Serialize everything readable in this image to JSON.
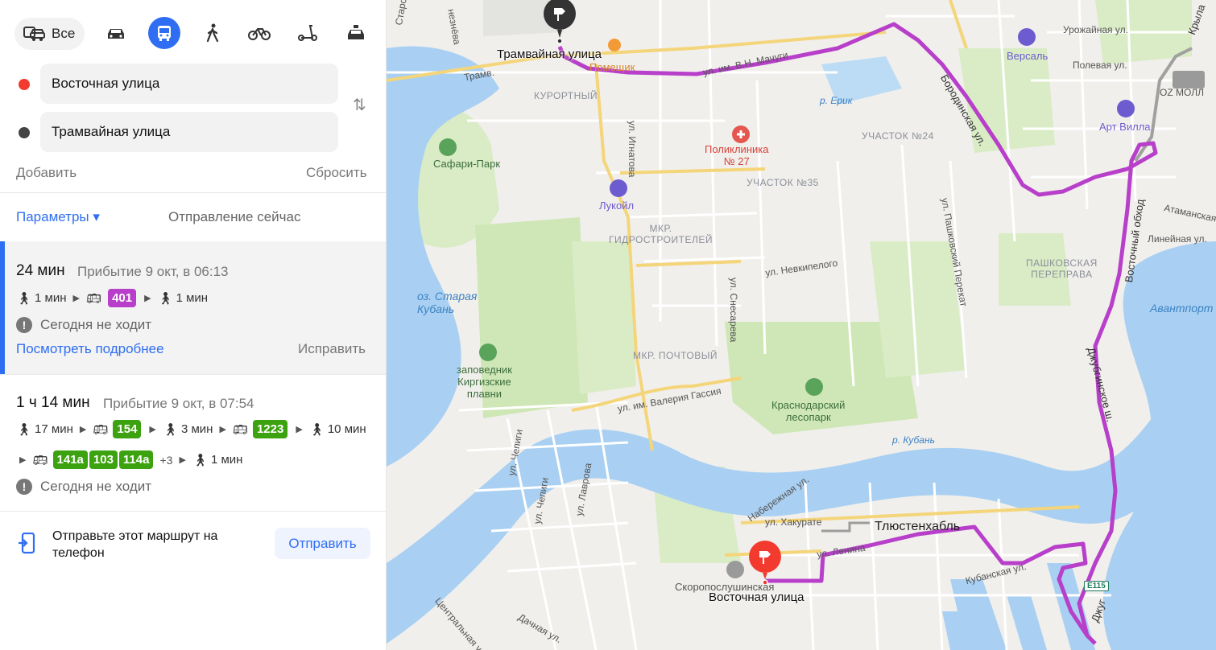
{
  "modes": {
    "all_label": "Все",
    "items": [
      {
        "name": "car-icon"
      },
      {
        "name": "bus-icon",
        "active": true
      },
      {
        "name": "walk-icon"
      },
      {
        "name": "bike-icon"
      },
      {
        "name": "scooter-icon"
      },
      {
        "name": "taxi-icon"
      }
    ]
  },
  "from": {
    "value": "Восточная улица",
    "color": "#f33a2f"
  },
  "to": {
    "value": "Трамвайная улица",
    "color": "#444444"
  },
  "actions": {
    "add": "Добавить",
    "reset": "Сбросить"
  },
  "params": {
    "label": "Параметры ▾",
    "departure": "Отправление сейчас"
  },
  "routes": [
    {
      "duration": "24 мин",
      "arrival": "Прибытие 9 окт, в 06:13",
      "walk1": "1 мин",
      "lines": [
        "401"
      ],
      "walk2": "1 мин",
      "status": "Сегодня не ходит",
      "details": "Посмотреть подробнее",
      "fix": "Исправить"
    },
    {
      "duration": "1 ч 14 мин",
      "arrival": "Прибытие 9 окт, в 07:54",
      "walk1": "17 мин",
      "line_a": "154",
      "walk2": "3 мин",
      "line_b": "1223",
      "walk3": "10 мин",
      "lines_c": [
        "141а",
        "103",
        "114а"
      ],
      "more": "+3",
      "walk4": "1 мин",
      "status": "Сегодня не ходит"
    }
  ],
  "send": {
    "text": "Отправьте этот маршрут на телефон",
    "button": "Отправить"
  },
  "colors": {
    "accent": "#2f6ef2",
    "route": "#b73fc9",
    "line_green": "#3ca20f"
  },
  "map": {
    "labels": {
      "tram_stop": "Трамвайная улица",
      "east_stop": "Восточная улица",
      "kurortny": "КУРОРТНЫЙ",
      "pomeshchik": "Помещик",
      "machuhi": "ул. им. В.Н. Мачуги",
      "versal": "Версаль",
      "oz_moll": "OZ МОЛЛ",
      "art_villa": "Арт Вилла",
      "urozhaynaya": "Урожайная ул.",
      "polevaya": "Полевая ул.",
      "erik": "р. Ерик",
      "uchastok24": "УЧАСТОК №24",
      "poliklinika": "Поликлиника\n№ 27",
      "ignatova": "ул. Игнатова",
      "safari": "Сафари-Парк",
      "uchastok35": "УЧАСТОК №35",
      "lukoil": "Лукойл",
      "gidro": "МКР.\nГИДРОСТРОИТЕЛЕЙ",
      "nevkipelogo": "ул. Невкипелого",
      "pashkovsky_per": "ул. Пашковский Перекат",
      "pashkovskaya": "ПАШКОВСКАЯ\nПЕРЕПРАВА",
      "atamanskaya": "Атаманская",
      "lineynaya": "Линейная ул.",
      "vostochny_obhod": "Восточный обход",
      "borodinskaya": "Бородинская ул.",
      "avanport": "Авантпорт",
      "staraya_kuban": "оз. Старая\nКубань",
      "snesareva": "ул. Снесарева",
      "pochtovy": "МКР. ПОЧТОВЫЙ",
      "zapovednik": "заповедник\nКиргизские\nплавни",
      "gassiya": "ул. им. Валерия Гассия",
      "lesopark": "Краснодарский\nлесопарк",
      "dzhubginskoe": "Джубгинское ш.",
      "kuban": "р. Кубань",
      "chepigi": "ул. Чепиги",
      "chepigi2": "ул. Чепиги",
      "lavrova": "ул. Лаврова",
      "naberezhnaya": "Набережная ул.",
      "hakurate": "ул. Хакурате",
      "tlyustenhabl": "Тлюстенхабль",
      "lenina": "ул. Ленина",
      "kubanskaya": "Кубанская ул.",
      "skorbyashchaya": "Скоропослушинская",
      "dachnaya": "Дачная ул.",
      "centralnaya": "Центральная ул.",
      "starokorsunskaya": "Староку",
      "neznaeva": "незнёва",
      "tramv": "Трамв.",
      "e115": "E115",
      "krylatskaya": "Крыла",
      "dzhug": "Джуг"
    }
  }
}
